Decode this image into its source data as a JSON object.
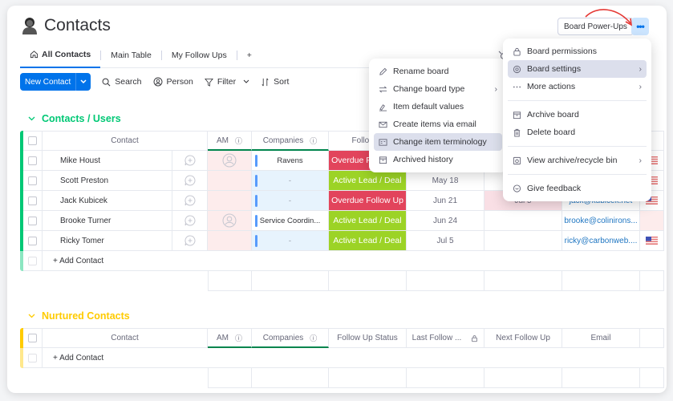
{
  "header": {
    "title": "Contacts",
    "power_ups_label": "Board Power-Ups",
    "more_label": "•••"
  },
  "tabs": [
    {
      "label": "All Contacts",
      "active": true
    },
    {
      "label": "Main Table"
    },
    {
      "label": "My Follow Ups"
    },
    {
      "label": "+"
    }
  ],
  "toolbar": {
    "new_label": "New Contact",
    "search": "Search",
    "person": "Person",
    "filter": "Filter",
    "sort": "Sort"
  },
  "columns": {
    "contact": "Contact",
    "am": "AM",
    "companies": "Companies",
    "follow_up_status": "Follow Up Status",
    "follow_up_status_short": "Follow U",
    "last_follow": "Last Follow ...",
    "next_follow": "Next Follow Up",
    "email": "Email"
  },
  "groups": [
    {
      "title": "Contacts / Users",
      "color": "#00c875",
      "add_label": "+ Add Contact",
      "rows": [
        {
          "name": "Mike Houst",
          "am": true,
          "company": "Ravens",
          "status": "Overdue Follow Up",
          "status_color": "#e2445c",
          "last": "",
          "next": "",
          "email": "",
          "flag": true
        },
        {
          "name": "Scott Preston",
          "am": false,
          "company": "-",
          "status": "Active Lead / Deal",
          "status_color": "#9cd326",
          "last": "May 18",
          "next": "",
          "email": "",
          "flag": true
        },
        {
          "name": "Jack Kubicek",
          "am": false,
          "company": "-",
          "status": "Overdue Follow Up",
          "status_color": "#e2445c",
          "last": "Jun 21",
          "next": "Jul 5",
          "email": "jack@kubicek.net",
          "flag": true
        },
        {
          "name": "Brooke Turner",
          "am": true,
          "company": "Service Coordin...",
          "status": "Active Lead / Deal",
          "status_color": "#9cd326",
          "last": "Jun 24",
          "next": "",
          "email": "brooke@colinirons...",
          "flag": false
        },
        {
          "name": "Ricky Tomer",
          "am": false,
          "company": "-",
          "status": "Active Lead / Deal",
          "status_color": "#9cd326",
          "last": "Jul 5",
          "next": "",
          "email": "ricky@carbonweb....",
          "flag": true
        }
      ]
    },
    {
      "title": "Nurtured Contacts",
      "color": "#ffcb00",
      "add_label": "+ Add Contact",
      "rows": []
    }
  ],
  "board_menu": {
    "items": [
      {
        "label": "Board permissions",
        "icon": "lock-icon"
      },
      {
        "label": "Board settings",
        "icon": "gear-icon",
        "submenu": true,
        "highlighted": true
      },
      {
        "label": "More actions",
        "icon": "dots-icon",
        "submenu": true
      },
      {
        "label": "Archive board",
        "icon": "archive-icon"
      },
      {
        "label": "Delete board",
        "icon": "trash-icon"
      },
      {
        "label": "View archive/recycle bin",
        "icon": "recycle-bin-icon",
        "submenu": true
      },
      {
        "label": "Give feedback",
        "icon": "feedback-icon"
      }
    ]
  },
  "settings_menu": {
    "items": [
      {
        "label": "Rename board",
        "icon": "pencil-icon"
      },
      {
        "label": "Change board type",
        "icon": "swap-icon",
        "submenu": true
      },
      {
        "label": "Item default values",
        "icon": "pen-line-icon"
      },
      {
        "label": "Create items via email",
        "icon": "email-icon"
      },
      {
        "label": "Change item terminology",
        "icon": "id-card-icon",
        "highlighted": true
      },
      {
        "label": "Archived history",
        "icon": "archive-icon"
      }
    ]
  },
  "colors": {
    "primary": "#0073ea",
    "overdue": "#e2445c",
    "active": "#9cd326",
    "group_green": "#00c875",
    "group_yellow": "#ffcb00"
  }
}
